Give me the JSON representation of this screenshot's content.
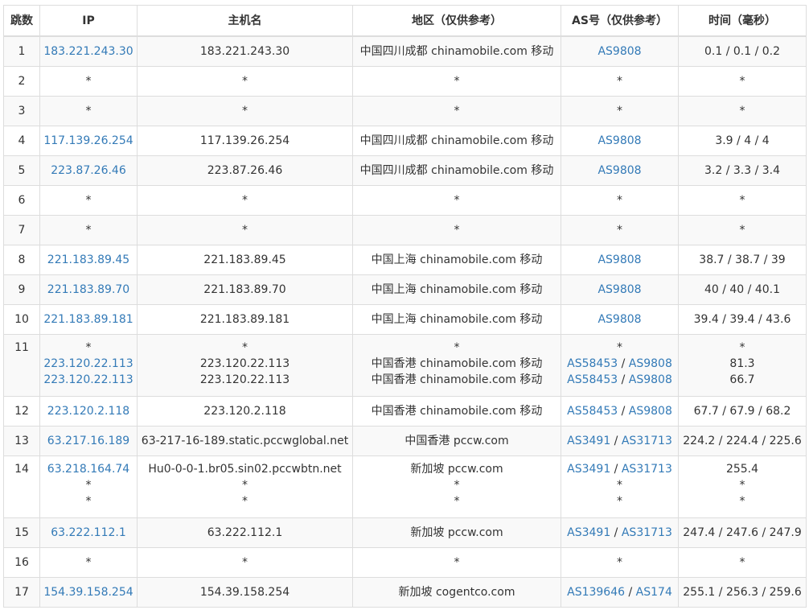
{
  "headers": {
    "hop": "跳数",
    "ip": "IP",
    "host": "主机名",
    "loc": "地区（仅供参考）",
    "as": "AS号（仅供参考）",
    "time": "时间（毫秒）"
  },
  "separator": " / ",
  "rows": [
    {
      "hop": "1",
      "lines": [
        {
          "ip": "183.221.243.30",
          "host": "183.221.243.30",
          "loc": "中国四川成都 chinamobile.com 移动",
          "as": [
            "AS9808"
          ],
          "time": "0.1 / 0.1 / 0.2"
        }
      ]
    },
    {
      "hop": "2",
      "lines": [
        {
          "ip": "*",
          "host": "*",
          "loc": "*",
          "as": [
            "*"
          ],
          "time": "*"
        }
      ]
    },
    {
      "hop": "3",
      "lines": [
        {
          "ip": "*",
          "host": "*",
          "loc": "*",
          "as": [
            "*"
          ],
          "time": "*"
        }
      ]
    },
    {
      "hop": "4",
      "lines": [
        {
          "ip": "117.139.26.254",
          "host": "117.139.26.254",
          "loc": "中国四川成都 chinamobile.com 移动",
          "as": [
            "AS9808"
          ],
          "time": "3.9 / 4 / 4"
        }
      ]
    },
    {
      "hop": "5",
      "lines": [
        {
          "ip": "223.87.26.46",
          "host": "223.87.26.46",
          "loc": "中国四川成都 chinamobile.com 移动",
          "as": [
            "AS9808"
          ],
          "time": "3.2 / 3.3 / 3.4"
        }
      ]
    },
    {
      "hop": "6",
      "lines": [
        {
          "ip": "*",
          "host": "*",
          "loc": "*",
          "as": [
            "*"
          ],
          "time": "*"
        }
      ]
    },
    {
      "hop": "7",
      "lines": [
        {
          "ip": "*",
          "host": "*",
          "loc": "*",
          "as": [
            "*"
          ],
          "time": "*"
        }
      ]
    },
    {
      "hop": "8",
      "lines": [
        {
          "ip": "221.183.89.45",
          "host": "221.183.89.45",
          "loc": "中国上海 chinamobile.com 移动",
          "as": [
            "AS9808"
          ],
          "time": "38.7 / 38.7 / 39"
        }
      ]
    },
    {
      "hop": "9",
      "lines": [
        {
          "ip": "221.183.89.70",
          "host": "221.183.89.70",
          "loc": "中国上海 chinamobile.com 移动",
          "as": [
            "AS9808"
          ],
          "time": "40 / 40 / 40.1"
        }
      ]
    },
    {
      "hop": "10",
      "lines": [
        {
          "ip": "221.183.89.181",
          "host": "221.183.89.181",
          "loc": "中国上海 chinamobile.com 移动",
          "as": [
            "AS9808"
          ],
          "time": "39.4 / 39.4 / 43.6"
        }
      ]
    },
    {
      "hop": "11",
      "lines": [
        {
          "ip": "*",
          "host": "*",
          "loc": "*",
          "as": [
            "*"
          ],
          "time": "*"
        },
        {
          "ip": "223.120.22.113",
          "host": "223.120.22.113",
          "loc": "中国香港 chinamobile.com 移动",
          "as": [
            "AS58453",
            "AS9808"
          ],
          "time": "81.3"
        },
        {
          "ip": "223.120.22.113",
          "host": "223.120.22.113",
          "loc": "中国香港 chinamobile.com 移动",
          "as": [
            "AS58453",
            "AS9808"
          ],
          "time": "66.7"
        }
      ]
    },
    {
      "hop": "12",
      "lines": [
        {
          "ip": "223.120.2.118",
          "host": "223.120.2.118",
          "loc": "中国香港 chinamobile.com 移动",
          "as": [
            "AS58453",
            "AS9808"
          ],
          "time": "67.7 / 67.9 / 68.2"
        }
      ]
    },
    {
      "hop": "13",
      "lines": [
        {
          "ip": "63.217.16.189",
          "host": "63-217-16-189.static.pccwglobal.net",
          "loc": "中国香港 pccw.com",
          "as": [
            "AS3491",
            "AS31713"
          ],
          "time": "224.2 / 224.4 / 225.6"
        }
      ]
    },
    {
      "hop": "14",
      "lines": [
        {
          "ip": "63.218.164.74",
          "host": "Hu0-0-0-1.br05.sin02.pccwbtn.net",
          "loc": "新加坡 pccw.com",
          "as": [
            "AS3491",
            "AS31713"
          ],
          "time": "255.4"
        },
        {
          "ip": "*",
          "host": "*",
          "loc": "*",
          "as": [
            "*"
          ],
          "time": "*"
        },
        {
          "ip": "*",
          "host": "*",
          "loc": "*",
          "as": [
            "*"
          ],
          "time": "*"
        }
      ]
    },
    {
      "hop": "15",
      "lines": [
        {
          "ip": "63.222.112.1",
          "host": "63.222.112.1",
          "loc": "新加坡 pccw.com",
          "as": [
            "AS3491",
            "AS31713"
          ],
          "time": "247.4 / 247.6 / 247.9"
        }
      ]
    },
    {
      "hop": "16",
      "lines": [
        {
          "ip": "*",
          "host": "*",
          "loc": "*",
          "as": [
            "*"
          ],
          "time": "*"
        }
      ]
    },
    {
      "hop": "17",
      "lines": [
        {
          "ip": "154.39.158.254",
          "host": "154.39.158.254",
          "loc": "新加坡 cogentco.com",
          "as": [
            "AS139646",
            "AS174"
          ],
          "time": "255.1 / 256.3 / 259.6"
        }
      ]
    }
  ]
}
